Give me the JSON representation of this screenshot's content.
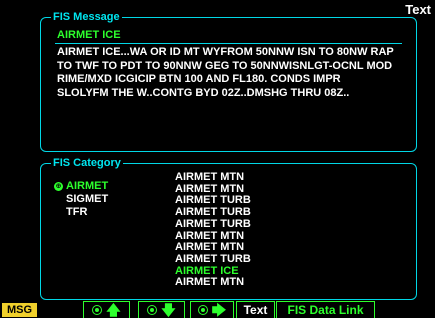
{
  "corner_title": "Text",
  "message_panel": {
    "title": "FIS Message",
    "header": "AIRMET ICE",
    "body": "AIRMET ICE...WA OR ID MT WYFROM 50NNW ISN TO 80NW RAP\nTO TWF TO PDT TO 90NNW GEG TO 50NNWISNLGT-OCNL MOD\nRIME/MXD ICGICIP BTN 100 AND FL180. CONDS IMPR\nSLOLYFM THE W..CONTG BYD 02Z..DMSHG THRU 08Z.."
  },
  "category_panel": {
    "title": "FIS Category",
    "categories": [
      {
        "label": "AIRMET",
        "selected": true
      },
      {
        "label": "SIGMET",
        "selected": false
      },
      {
        "label": "TFR",
        "selected": false
      }
    ],
    "items": [
      {
        "label": "AIRMET MTN",
        "selected": false
      },
      {
        "label": "AIRMET MTN",
        "selected": false
      },
      {
        "label": "AIRMET TURB",
        "selected": false
      },
      {
        "label": "AIRMET TURB",
        "selected": false
      },
      {
        "label": "AIRMET TURB",
        "selected": false
      },
      {
        "label": "AIRMET MTN",
        "selected": false
      },
      {
        "label": "AIRMET MTN",
        "selected": false
      },
      {
        "label": "AIRMET TURB",
        "selected": false
      },
      {
        "label": "AIRMET ICE",
        "selected": true
      },
      {
        "label": "AIRMET MTN",
        "selected": false
      }
    ]
  },
  "softkeys": {
    "msg": "MSG",
    "up_icon": "knob-up-arrow-icon",
    "down_icon": "knob-down-arrow-icon",
    "right_icon": "knob-right-arrow-icon",
    "text": "Text",
    "data_link": "FIS Data Link"
  },
  "colors": {
    "border": "#00d7e6",
    "selected": "#2dff2d",
    "msg_key": "#f0d02c"
  }
}
